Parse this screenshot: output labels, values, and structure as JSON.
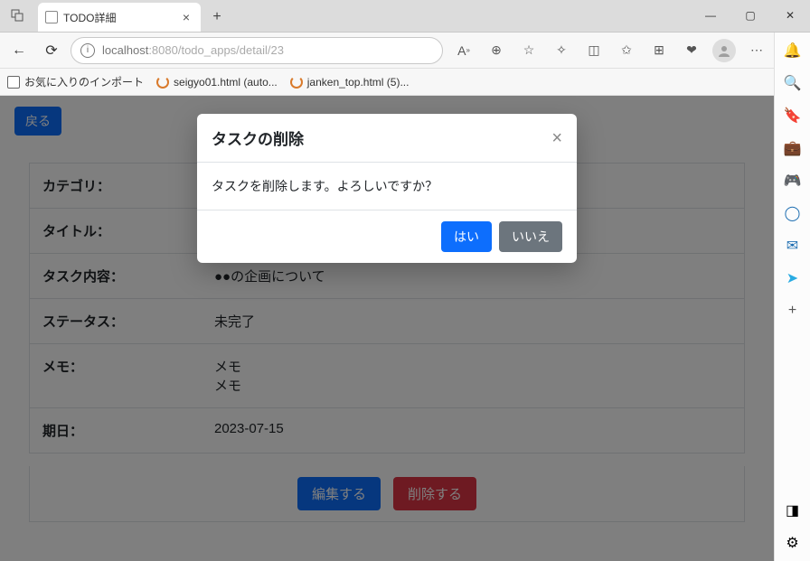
{
  "browser": {
    "tab_title": "TODO詳細",
    "url_host": "localhost",
    "url_port_path": ":8080/todo_apps/detail/23",
    "bookmarks": {
      "import_label": "お気に入りのインポート",
      "bm1": "seigyo01.html (auto...",
      "bm2": "janken_top.html (5)..."
    }
  },
  "page": {
    "back_label": "戻る",
    "fields": {
      "category_label": "カテゴリ：",
      "category_value": "",
      "title_label": "タイトル：",
      "title_value": "",
      "content_label": "タスク内容：",
      "content_value": "●●の企画について",
      "status_label": "ステータス：",
      "status_value": "未完了",
      "memo_label": "メモ：",
      "memo_value": "メモ\nメモ",
      "due_label": "期日：",
      "due_value": "2023-07-15"
    },
    "edit_label": "編集する",
    "delete_label": "削除する"
  },
  "modal": {
    "title": "タスクの削除",
    "body": "タスクを削除します。よろしいですか？",
    "yes_label": "はい",
    "no_label": "いいえ"
  }
}
